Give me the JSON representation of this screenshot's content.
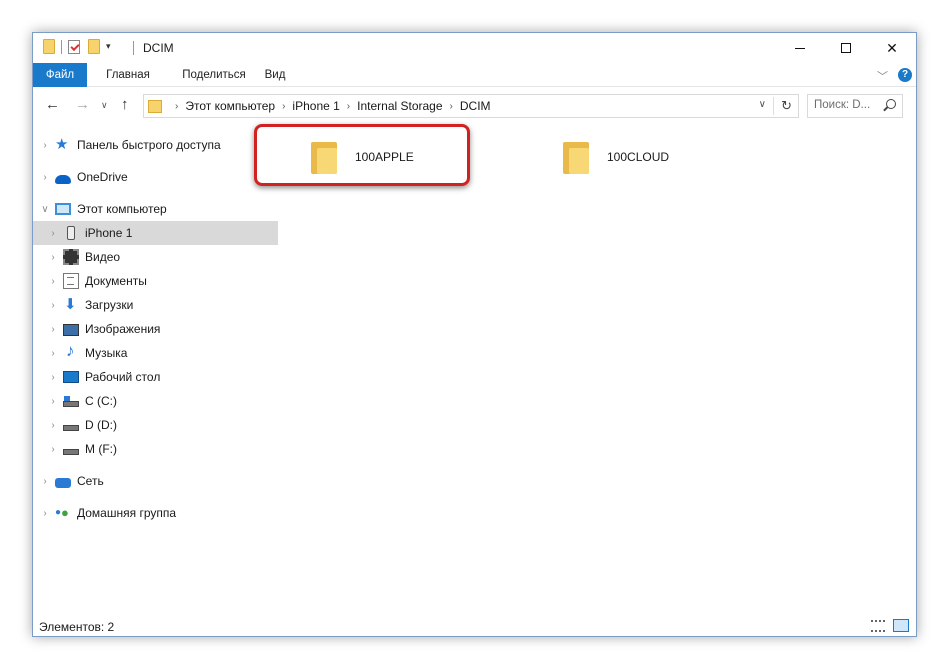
{
  "window": {
    "title": "DCIM"
  },
  "ribbon": {
    "tabs": [
      "Файл",
      "Главная",
      "Поделиться",
      "Вид"
    ]
  },
  "address": {
    "breadcrumbs": [
      "Этот компьютер",
      "iPhone 1",
      "Internal Storage",
      "DCIM"
    ],
    "search_placeholder": "Поиск: D..."
  },
  "sidebar": {
    "items": [
      {
        "label": "Панель быстрого доступа",
        "icon": "star-icon"
      },
      {
        "label": "OneDrive",
        "icon": "cloud-icon"
      },
      {
        "label": "Этот компьютер",
        "icon": "computer-icon"
      },
      {
        "label": "iPhone 1",
        "icon": "phone-icon",
        "selected": true
      },
      {
        "label": "Видео",
        "icon": "video-icon"
      },
      {
        "label": "Документы",
        "icon": "documents-icon"
      },
      {
        "label": "Загрузки",
        "icon": "download-icon"
      },
      {
        "label": "Изображения",
        "icon": "pictures-icon"
      },
      {
        "label": "Музыка",
        "icon": "music-icon"
      },
      {
        "label": "Рабочий стол",
        "icon": "desktop-icon"
      },
      {
        "label": "C (C:)",
        "icon": "drive-icon"
      },
      {
        "label": "D (D:)",
        "icon": "drive-icon"
      },
      {
        "label": "M (F:)",
        "icon": "drive-icon"
      },
      {
        "label": "Сеть",
        "icon": "network-icon"
      },
      {
        "label": "Домашняя группа",
        "icon": "homegroup-icon"
      }
    ]
  },
  "content": {
    "folders": [
      "100APPLE",
      "100CLOUD"
    ]
  },
  "status": {
    "items_count": "Элементов: 2"
  },
  "colors": {
    "accent": "#1979ca",
    "highlight": "#d12121",
    "selected_bg": "#d9d9d9"
  }
}
